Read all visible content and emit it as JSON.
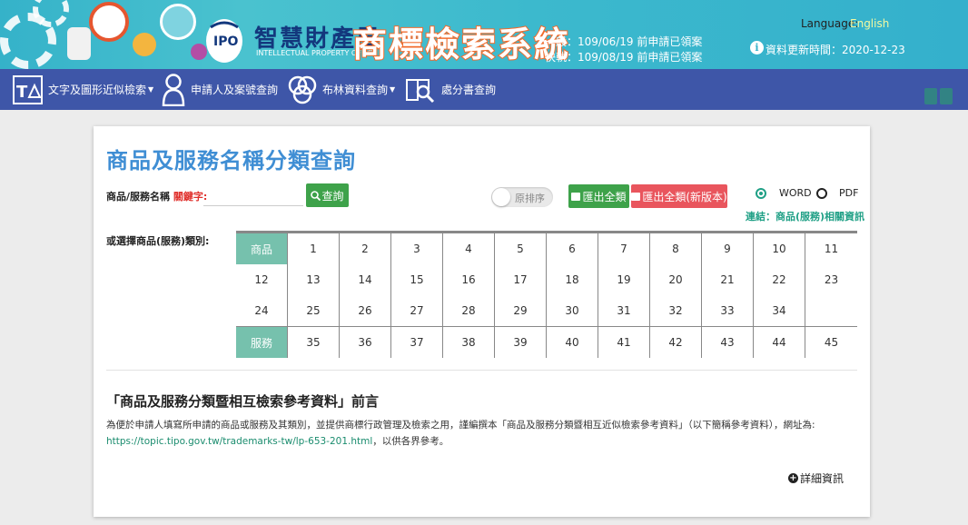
{
  "header": {
    "logo_cn": "智慧財產局",
    "logo_en": "INTELLECTUAL PROPERTY OFFICE",
    "logo_mark": "IPO",
    "system_title": "商標檢索系統",
    "notice_general": "一般：109/06/19 前申請已領案",
    "notice_fast": "快軌：109/08/19 前申請已領案",
    "language_label": "Language:",
    "language_value": "English",
    "update_label": "資料更新時間：2020-12-23"
  },
  "nav": {
    "items": [
      {
        "label": "文字及圖形近似檢索",
        "icon": "text-shape-icon",
        "has_dropdown": true
      },
      {
        "label": "申請人及案號查詢",
        "icon": "person-icon",
        "has_dropdown": false
      },
      {
        "label": "布林資料查詢",
        "icon": "venn-icon",
        "has_dropdown": true
      },
      {
        "label": "處分書查詢",
        "icon": "document-search-icon",
        "has_dropdown": false
      }
    ]
  },
  "main": {
    "title": "商品及服務名稱分類查詢",
    "search_label": "商品/服務名稱",
    "keyword_label": "關鍵字:",
    "search_placeholder": "",
    "search_button": "查詢",
    "sort_toggle_label": "原排序",
    "export_all_button": "匯出全類",
    "export_all_new_button": "匯出全類(新版本)",
    "format_options": [
      {
        "label": "WORD",
        "checked": true
      },
      {
        "label": "PDF",
        "checked": false
      }
    ],
    "related_link": "連結：商品(服務)相關資訊",
    "category_label": "或選擇商品(服務)類別:",
    "goods_header": "商品",
    "services_header": "服務",
    "goods_rows": [
      [
        "1",
        "2",
        "3",
        "4",
        "5",
        "6",
        "7",
        "8",
        "9",
        "10",
        "11"
      ],
      [
        "12",
        "13",
        "14",
        "15",
        "16",
        "17",
        "18",
        "19",
        "20",
        "21",
        "22",
        "23"
      ],
      [
        "24",
        "25",
        "26",
        "27",
        "28",
        "29",
        "30",
        "31",
        "32",
        "33",
        "34",
        ""
      ]
    ],
    "services_row": [
      "35",
      "36",
      "37",
      "38",
      "39",
      "40",
      "41",
      "42",
      "43",
      "44",
      "45"
    ],
    "intro_title": "「商品及服務分類暨相互檢索參考資料」前言",
    "intro_text": "為便於申請人填寫所申請的商品或服務及其類別，並提供商標行政管理及檢索之用，謹編撰本「商品及服務分類暨相互近似檢索參考資料」（以下簡稱參考資料），網址為:",
    "intro_url": "https://topic.tipo.gov.tw/trademarks-tw/lp-653-201.html",
    "intro_suffix": "，以供各界參考。",
    "detail_button": "詳細資訊"
  },
  "colors": {
    "banner": "#35b2c9",
    "navbar": "#3e56a8",
    "title_blue": "#3f8ed4",
    "green_button": "#3ea24a",
    "red_button": "#e9555d",
    "grid_header": "#76c1ad",
    "link_green": "#20a086"
  }
}
